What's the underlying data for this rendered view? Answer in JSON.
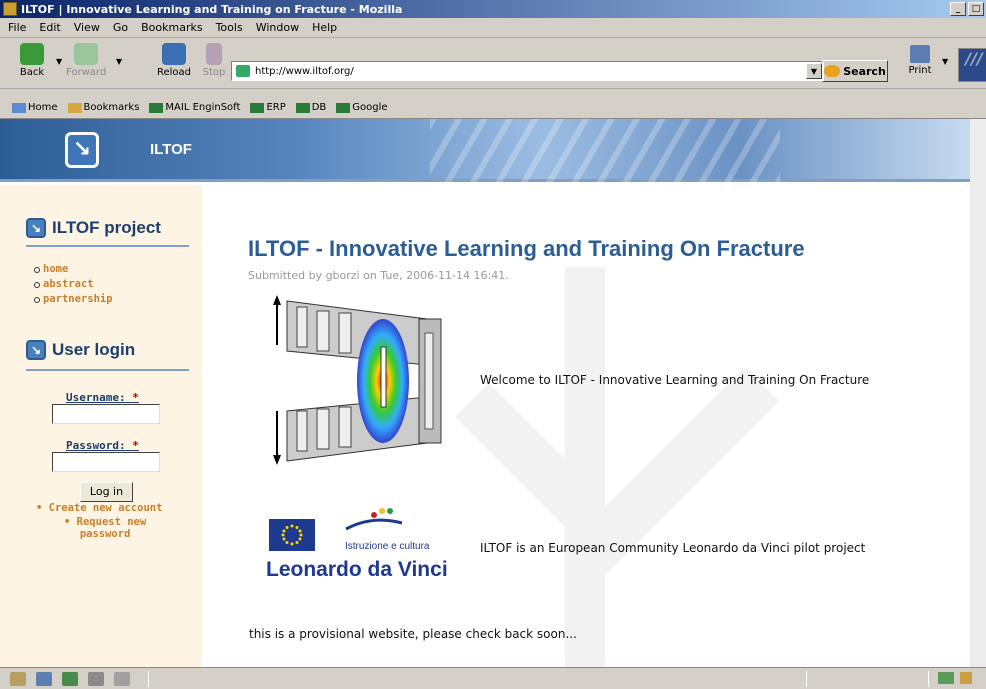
{
  "window": {
    "title": "ILTOF | Innovative Learning and Training on Fracture - Mozilla"
  },
  "menu": [
    "File",
    "Edit",
    "View",
    "Go",
    "Bookmarks",
    "Tools",
    "Window",
    "Help"
  ],
  "navbar": {
    "back": "Back",
    "forward": "Forward",
    "reload": "Reload",
    "stop": "Stop",
    "url": "http://www.iltof.org/",
    "search": "Search",
    "print": "Print"
  },
  "bookmarks": [
    "Home",
    "Bookmarks",
    "MAIL EnginSoft",
    "ERP",
    "DB",
    "Google"
  ],
  "site": {
    "name": "ILTOF",
    "logo_glyph": "↘"
  },
  "sidebar": {
    "project_title": "ILTOF project",
    "project_links": [
      "home",
      "abstract",
      "partnership"
    ],
    "login_title": "User login",
    "username_label": "Username:",
    "password_label": "Password:",
    "required_mark": "*",
    "login_button": "Log in",
    "create_account": "Create new account",
    "request_password_1": "Request new",
    "request_password_2": "password"
  },
  "content": {
    "title": "ILTOF - Innovative Learning and Training On Fracture",
    "submitted": "Submitted by gborzi on Tue, 2006-11-14 16:41.",
    "welcome": "Welcome to ILTOF - Innovative Learning and Training On Fracture",
    "istruzione": "Istruzione e cultura",
    "leonardo": "Leonardo da Vinci",
    "community": "ILTOF is an European Community Leonardo da Vinci pilot project",
    "provisional": "this is a provisional website, please check back soon..."
  },
  "colors": {
    "brand_blue": "#2d5d95",
    "sidebar_bg": "#fdf4e3",
    "link_orange": "#c87f2a"
  }
}
